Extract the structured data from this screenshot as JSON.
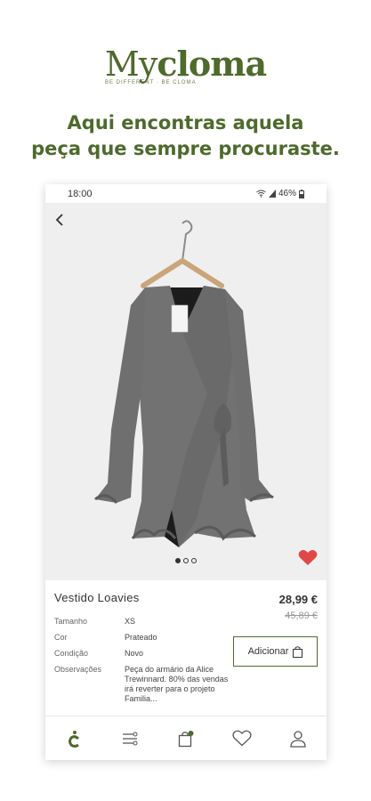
{
  "brand": {
    "prefix": "My",
    "name": "cloma",
    "tagline": "BE DIFFERENT · BE CLOMA"
  },
  "headline": {
    "line1": "Aqui encontras aquela",
    "line2": "peça que sempre procuraste."
  },
  "status_bar": {
    "time": "18:00",
    "battery": "46%"
  },
  "gallery": {
    "slides": 3,
    "active": 1
  },
  "product": {
    "title": "Vestido Loavies",
    "price": "28,99 €",
    "old_price": "45,89 €",
    "add_label": "Adicionar",
    "attributes": [
      {
        "key": "Tamanho",
        "value": "XS"
      },
      {
        "key": "Cor",
        "value": "Prateado"
      },
      {
        "key": "Condição",
        "value": "Novo"
      },
      {
        "key": "Observações",
        "value": "Peça do armário da Alice Trewinnard. 80% das vendas irá reverter para o projeto Familia..."
      }
    ]
  },
  "tabs": [
    "home-icon",
    "filter-icon",
    "cart-icon",
    "heart-icon",
    "profile-icon"
  ],
  "colors": {
    "brand": "#4e6a2c",
    "favorite": "#e04848",
    "background_image": "#efefef"
  }
}
